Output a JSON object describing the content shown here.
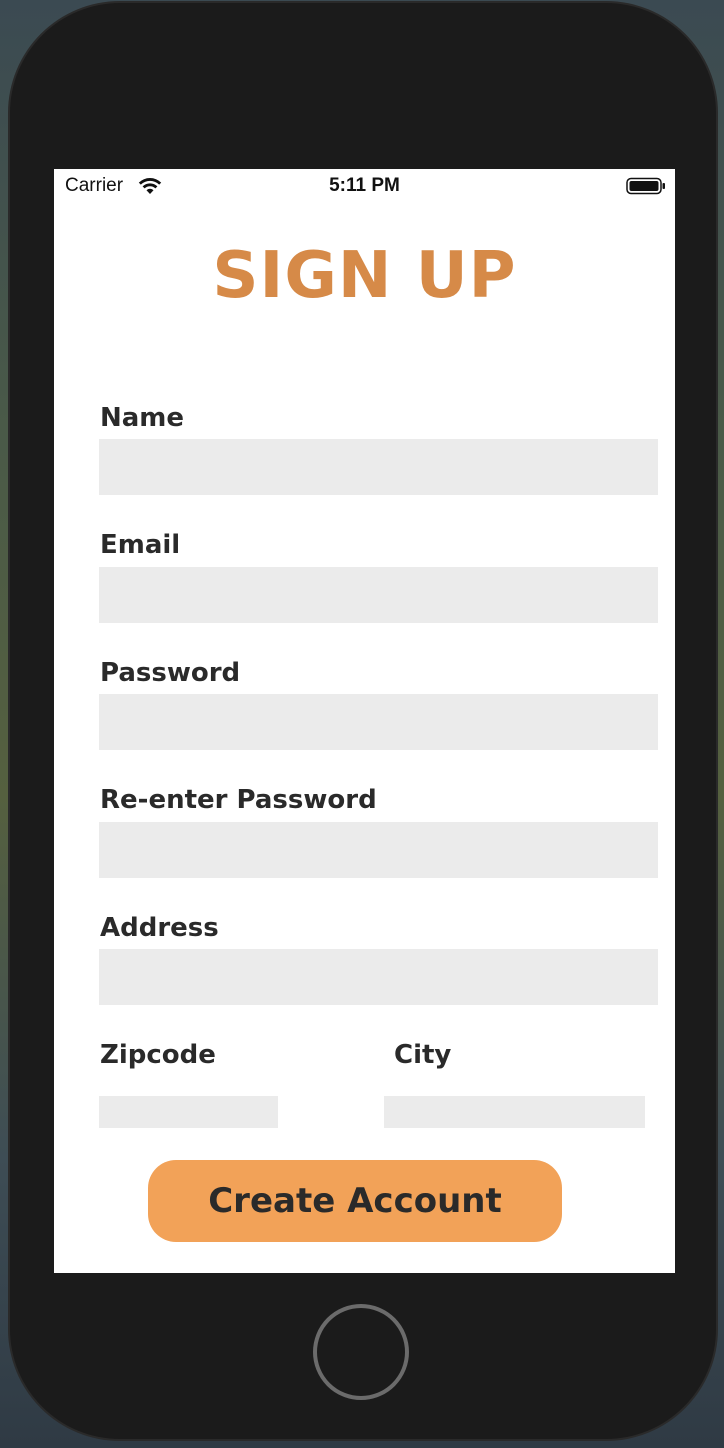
{
  "status_bar": {
    "carrier": "Carrier",
    "time": "5:11 PM"
  },
  "title": "SIGN UP",
  "fields": {
    "name": {
      "label": "Name",
      "value": ""
    },
    "email": {
      "label": "Email",
      "value": ""
    },
    "password": {
      "label": "Password",
      "value": ""
    },
    "reenter_password": {
      "label": "Re-enter Password",
      "value": ""
    },
    "address": {
      "label": "Address",
      "value": ""
    },
    "zipcode": {
      "label": "Zipcode",
      "value": ""
    },
    "city": {
      "label": "City",
      "value": ""
    }
  },
  "create_button_label": "Create Account",
  "colors": {
    "accent_title": "#d68a48",
    "button": "#f2a258",
    "input_bg": "#ebebeb"
  },
  "icons": [
    "wifi-icon",
    "battery-icon"
  ]
}
